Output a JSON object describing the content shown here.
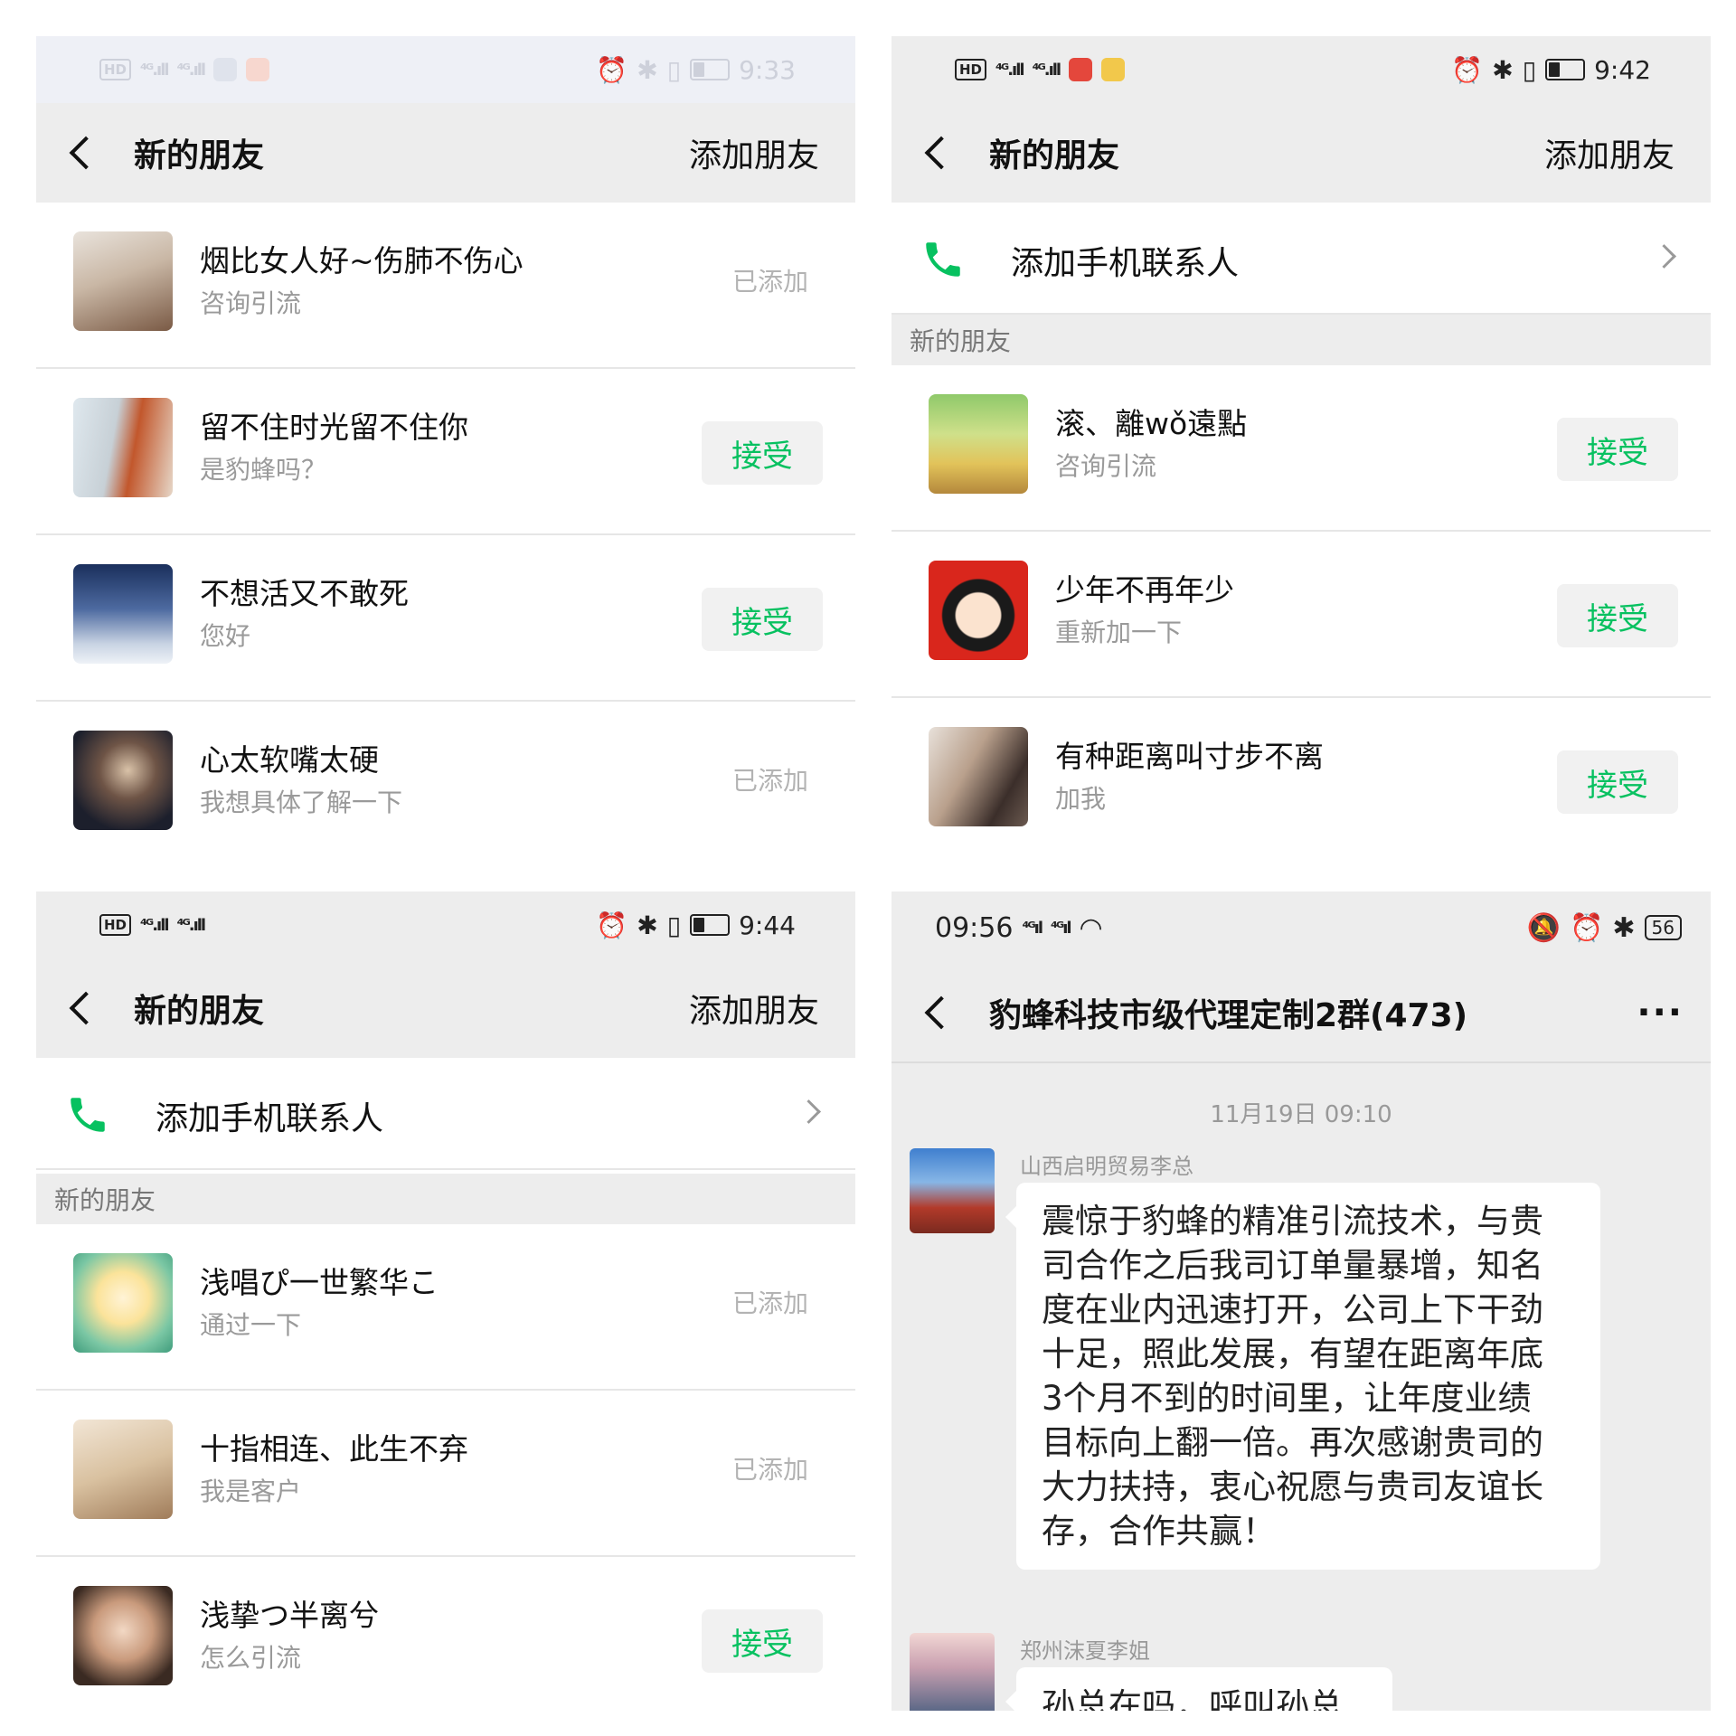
{
  "panels": {
    "top_left": {
      "status_time": "9:33",
      "title": "新的朋友",
      "action": "添加朋友",
      "rows": [
        {
          "name": "烟比女人好~伤肺不伤心",
          "message": "咨询引流",
          "status": "已添加"
        },
        {
          "name": "留不住时光留不住你",
          "message": "是豹蜂吗？",
          "status": "接受"
        },
        {
          "name": "不想活又不敢死",
          "message": "您好",
          "status": "接受"
        },
        {
          "name": "心太软嘴太硬",
          "message": "我想具体了解一下",
          "status": "已添加"
        }
      ]
    },
    "top_right": {
      "status_time": "9:42",
      "title": "新的朋友",
      "action": "添加朋友",
      "add_contacts": "添加手机联系人",
      "section": "新的朋友",
      "rows": [
        {
          "name": "滚、離wǒ遠點",
          "message": "咨询引流",
          "status": "接受"
        },
        {
          "name": "少年不再年少",
          "message": "重新加一下",
          "status": "接受"
        },
        {
          "name": "有种距离叫寸步不离",
          "message": "加我",
          "status": "接受"
        }
      ]
    },
    "bottom_left": {
      "status_time": "9:44",
      "title": "新的朋友",
      "action": "添加朋友",
      "add_contacts": "添加手机联系人",
      "section": "新的朋友",
      "rows": [
        {
          "name": "浅唱ぴ一世繁华こ",
          "message": "通过一下",
          "status": "已添加"
        },
        {
          "name": "十指相连、此生不弃",
          "message": "我是客户",
          "status": "已添加"
        },
        {
          "name": "浅挚つ半离兮",
          "message": "怎么引流",
          "status": "接受"
        }
      ]
    },
    "bottom_right": {
      "status_time": "09:56",
      "battery": "56",
      "title": "豹蜂科技市级代理定制2群(473)",
      "more": "···",
      "timestamp": "11月19日 09:10",
      "messages": [
        {
          "sender": "山西启明贸易李总",
          "lines": [
            "震惊于豹蜂的精准引流技术，与贵",
            "司合作之后我司订单量暴增，知名",
            "度在业内迅速打开，公司上下干劲",
            "十足，照此发展，有望在距离年底",
            "3个月不到的时间里，让年度业绩",
            "目标向上翻一倍。再次感谢贵司的",
            "大力扶持，衷心祝愿与贵司友谊长",
            "存，合作共赢！"
          ]
        },
        {
          "sender": "郑州沫夏李姐",
          "lines": [
            "孙总在吗，呼叫孙总😊"
          ]
        }
      ]
    }
  },
  "colors": {
    "wechat_green": "#07c160",
    "nav_bg": "#ededed",
    "muted_text": "#9a9a9a"
  }
}
